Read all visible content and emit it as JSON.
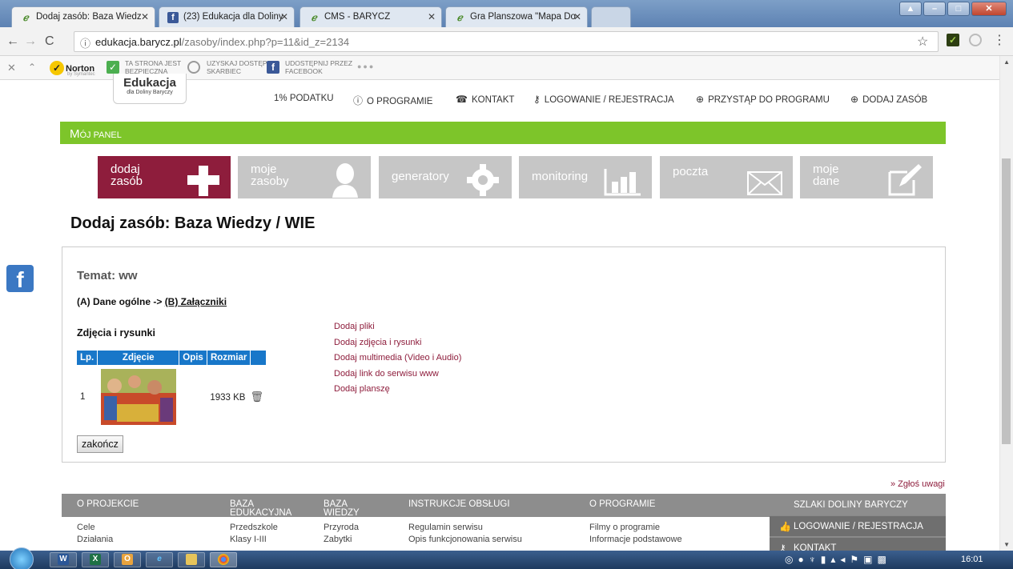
{
  "browser": {
    "tabs": [
      {
        "title": "Dodaj zasób: Baza Wiedz",
        "icon": "baryczy-leaf-icon"
      },
      {
        "title": "(23) Edukacja dla Doliny",
        "icon": "facebook-icon"
      },
      {
        "title": "CMS - BARYCZ",
        "icon": "baryczy-leaf-icon"
      },
      {
        "title": "Gra Planszowa \"Mapa Do",
        "icon": "baryczy-leaf-icon"
      }
    ],
    "url_host": "edukacja.barycz.pl",
    "url_path": "/zasoby/index.php?p=11&id_z=2134"
  },
  "norton_bar": {
    "brand": "Norton",
    "brand_sub": "by Symantec",
    "safe_line1": "TA STRONA JEST",
    "safe_line2": "BEZPIECZNA",
    "vault_line1": "UZYSKAJ DOSTĘP",
    "vault_line2": "SKARBIEC",
    "share_line1": "UDOSTĘPNIJ PRZEZ",
    "share_line2": "FACEBOOK"
  },
  "site": {
    "logo_main": "Edukacja",
    "logo_sub": "dla Doliny Baryczy",
    "nav": [
      "1% PODATKU",
      "O PROGRAMIE",
      "KONTAKT",
      "LOGOWANIE / REJESTRACJA",
      "PRZYSTĄP DO PROGRAMU",
      "DODAJ ZASÓB"
    ],
    "panel_first": "M",
    "panel_rest": "ÓJ PANEL",
    "tiles": [
      {
        "line1": "dodaj",
        "line2": "zasób"
      },
      {
        "line1": "moje",
        "line2": "zasoby"
      },
      {
        "line1": "generatory",
        "line2": ""
      },
      {
        "line1": "monitoring",
        "line2": ""
      },
      {
        "line1": "poczta",
        "line2": ""
      },
      {
        "line1": "moje",
        "line2": "dane"
      }
    ],
    "page_title": "Dodaj zasób: Baza Wiedzy / WIE",
    "topic": "Temat: ww",
    "breadcrumb_a": "(A) Dane ogólne ->",
    "breadcrumb_b": "(B) Załączniki",
    "section_title": "Zdjęcia i rysunki",
    "table_headers": [
      "Lp.",
      "Zdjęcie",
      "Opis",
      "Rozmiar"
    ],
    "rows": [
      {
        "lp": "1",
        "size": "1933 KB"
      }
    ],
    "add_links": [
      "Dodaj pliki",
      "Dodaj zdjęcia i rysunki",
      "Dodaj multimedia (Video i Audio)",
      "Dodaj link do serwisu www",
      "Dodaj planszę"
    ],
    "finish_button": "zakończ",
    "report_link": "» Zgłoś uwagi"
  },
  "footer": {
    "col1_head": "O PROJEKCIE",
    "col1_items": [
      "Cele",
      "Działania"
    ],
    "col2_head_1": "BAZA",
    "col2_head_2": "EDUKACYJNA",
    "col2_items": [
      "Przedszkole",
      "Klasy I-III"
    ],
    "col3_head_1": "BAZA",
    "col3_head_2": "WIEDZY",
    "col3_items": [
      "Przyroda",
      "Zabytki"
    ],
    "col4_head": "INSTRUKCJE OBSŁUGI",
    "col4_items": [
      "Regulamin serwisu",
      "Opis funkcjonowania serwisu"
    ],
    "col5_head": "O PROGRAMIE",
    "col5_items": [
      "Filmy o programie",
      "Informacje podstawowe"
    ],
    "side_head": "SZLAKI DOLINY BARYCZY",
    "side_items": [
      "LOGOWANIE / REJESTRACJA",
      "KONTAKT"
    ]
  },
  "taskbar": {
    "clock": "16:01"
  },
  "colors": {
    "accent_green": "#7dc52a",
    "accent_maroon": "#8e1d3c",
    "tile_grey": "#c6c6c6",
    "table_blue": "#1877c9"
  }
}
